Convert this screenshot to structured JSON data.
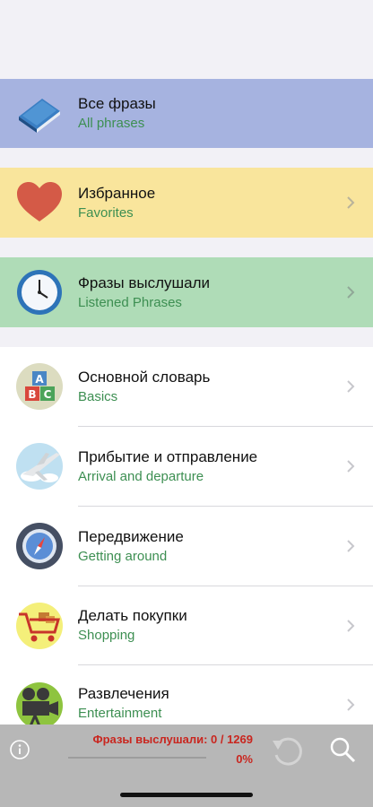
{
  "categories": [
    {
      "title": "Все фразы",
      "subtitle": "All phrases",
      "icon": "book-icon",
      "bg": "#a6b3e0"
    },
    {
      "title": "Избранное",
      "subtitle": "Favorites",
      "icon": "heart-icon",
      "bg": "#f9e59c"
    },
    {
      "title": "Фразы выслушали",
      "subtitle": "Listened Phrases",
      "icon": "clock-icon",
      "bg": "#afdcb7"
    },
    {
      "title": "Основной словарь",
      "subtitle": "Basics",
      "icon": "abc-blocks-icon",
      "bg": "#ffffff"
    },
    {
      "title": "Прибытие и отправление",
      "subtitle": "Arrival and departure",
      "icon": "airplane-icon",
      "bg": "#ffffff"
    },
    {
      "title": "Передвижение",
      "subtitle": "Getting around",
      "icon": "compass-icon",
      "bg": "#ffffff"
    },
    {
      "title": "Делать покупки",
      "subtitle": "Shopping",
      "icon": "shopping-cart-icon",
      "bg": "#ffffff"
    },
    {
      "title": "Развлечения",
      "subtitle": "Entertainment",
      "icon": "film-camera-icon",
      "bg": "#ffffff"
    }
  ],
  "footer": {
    "progress_label": "Фразы выслушали: 0 / 1269",
    "progress_percent": "0%",
    "progress_fraction": 0,
    "info_icon": "info-icon",
    "reset_icon": "reset-icon",
    "search_icon": "search-icon"
  }
}
